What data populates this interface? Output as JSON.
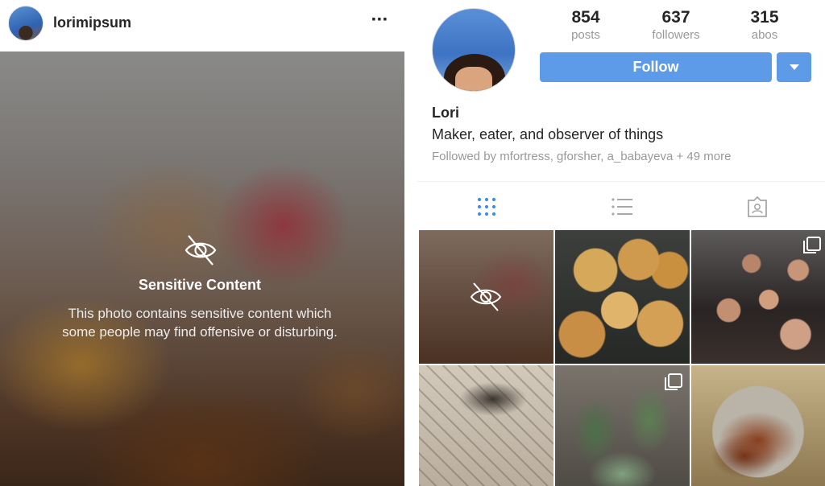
{
  "post": {
    "username": "lorimipsum",
    "more_icon": "more-horizontal-icon",
    "sensitive_title": "Sensitive Content",
    "sensitive_line1": "This photo contains sensitive content which",
    "sensitive_line2": "some people may find offensive or disturbing."
  },
  "profile": {
    "stats": [
      {
        "value": "854",
        "label": "posts"
      },
      {
        "value": "637",
        "label": "followers"
      },
      {
        "value": "315",
        "label": "abos"
      }
    ],
    "follow_label": "Follow",
    "name": "Lori",
    "bio": "Maker, eater, and observer of things",
    "followed_by": "Followed by mfortress, gforsher, a_babayeva + 49 more",
    "tabs": [
      "grid-icon",
      "list-icon",
      "tagged-icon"
    ],
    "accent_color": "#5d9be8"
  }
}
